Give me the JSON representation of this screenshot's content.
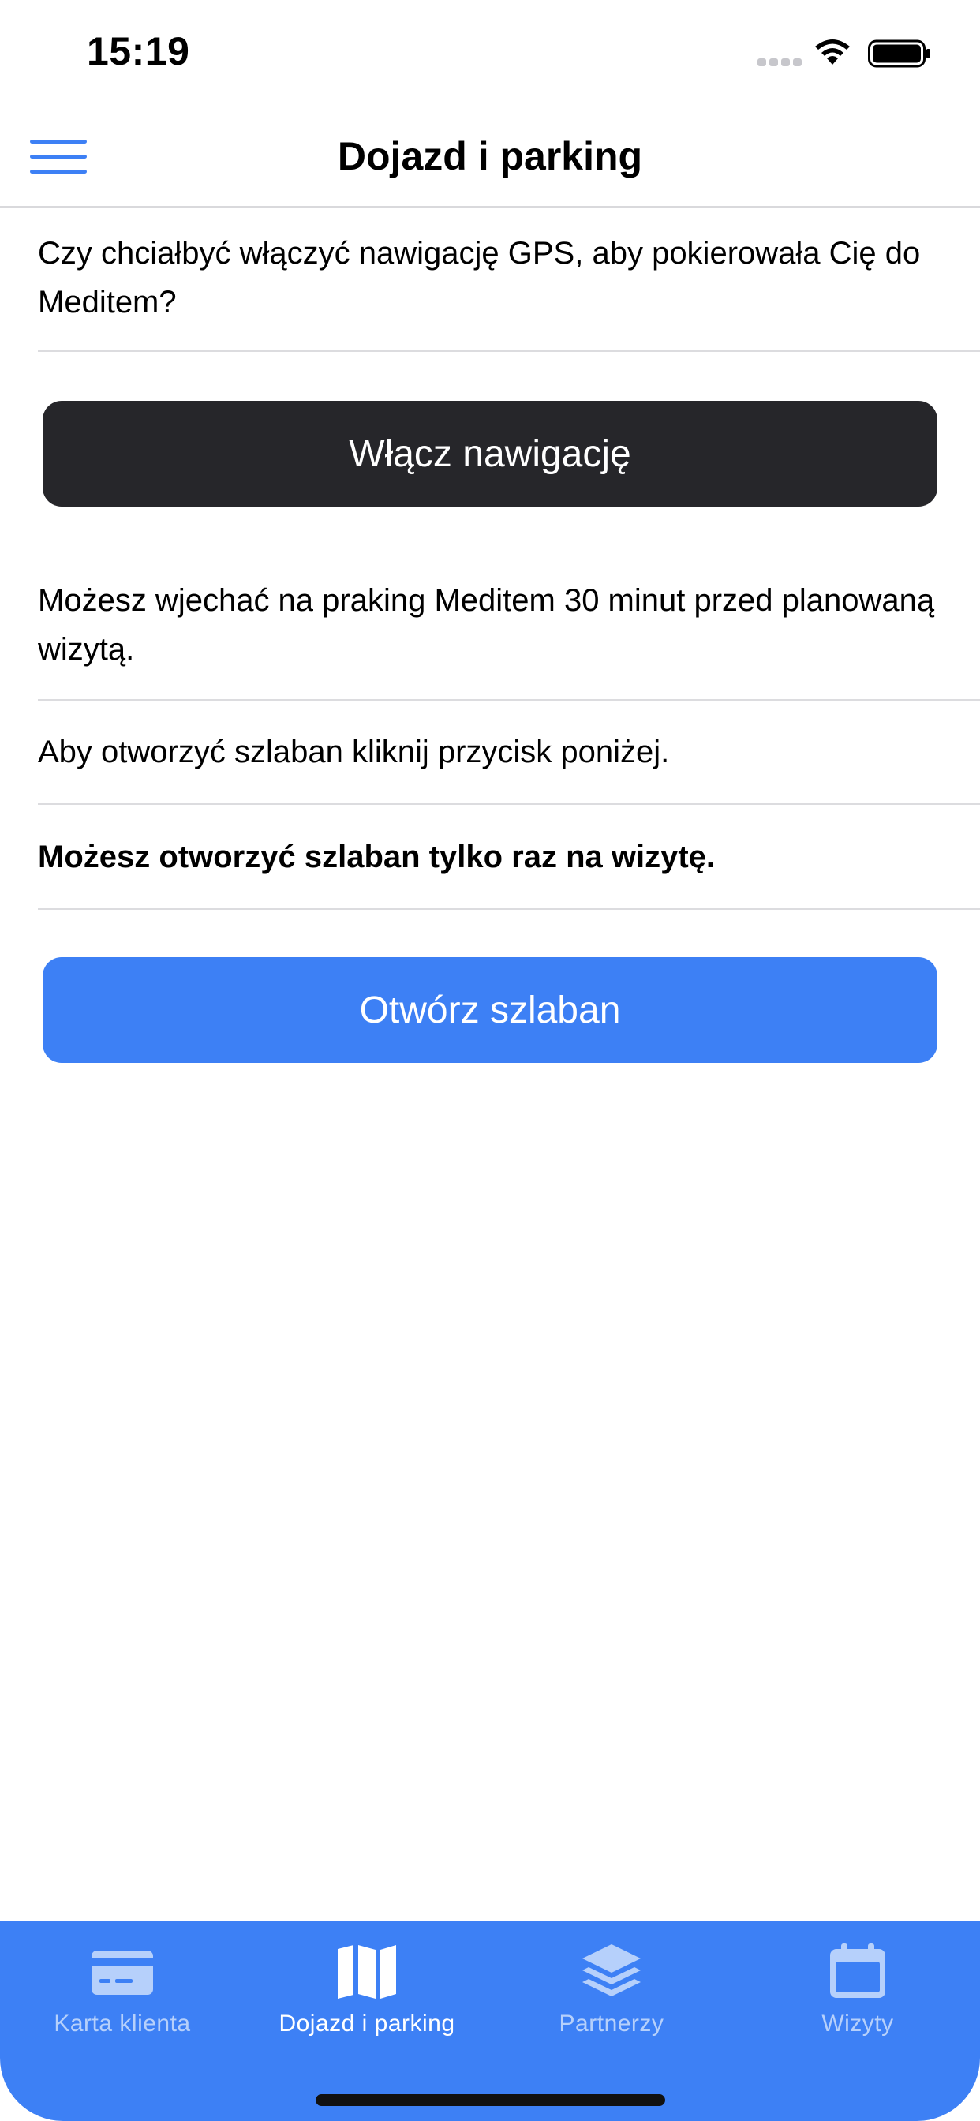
{
  "status_bar": {
    "time": "15:19"
  },
  "nav": {
    "title": "Dojazd i parking"
  },
  "content": {
    "gps_question": "Czy chciałbyć włączyć nawigację GPS, aby pokierowała Cię do Meditem?",
    "navigation_button": "Włącz nawigację",
    "parking_info": "Możesz wjechać na praking Meditem 30 minut przed planowaną wizytą.",
    "open_barrier_hint": "Aby otworzyć szlaban kliknij przycisk poniżej.",
    "once_per_visit": "Możesz otworzyć szlaban tylko raz na wizytę.",
    "open_barrier_button": "Otwórz szlaban"
  },
  "tabs": [
    {
      "label": "Karta klienta",
      "icon": "credit-card-icon",
      "active": false
    },
    {
      "label": "Dojazd i parking",
      "icon": "map-icon",
      "active": true
    },
    {
      "label": "Partnerzy",
      "icon": "layers-icon",
      "active": false
    },
    {
      "label": "Wizyty",
      "icon": "calendar-icon",
      "active": false
    }
  ],
  "colors": {
    "accent": "#3d80f5",
    "dark_button": "#26262a",
    "inactive_tab_label": "#b6d0fb"
  }
}
